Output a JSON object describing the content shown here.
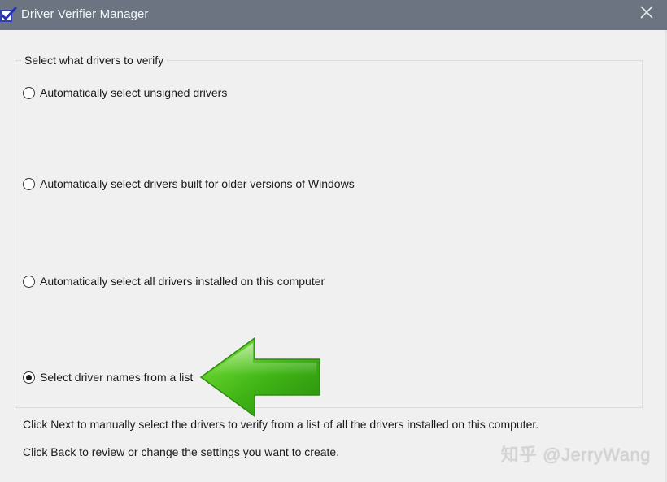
{
  "window": {
    "title": "Driver Verifier Manager",
    "close_glyph": "✕",
    "app_icon": "driver-verifier-checkbox-icon"
  },
  "group": {
    "legend": "Select what drivers to verify",
    "options": [
      {
        "label": "Automatically select unsigned drivers",
        "selected": false
      },
      {
        "label": "Automatically select drivers built for older versions of Windows",
        "selected": false
      },
      {
        "label": "Automatically select all drivers installed on this computer",
        "selected": false
      },
      {
        "label": "Select driver names from a list",
        "selected": true
      }
    ]
  },
  "info": {
    "next_text": "Click Next to manually select the drivers to verify from a list of all the drivers installed on this computer.",
    "back_text": "Click Back to review or change the settings you want to create."
  },
  "annotation": {
    "icon": "green-arrow-left-icon"
  },
  "watermark": {
    "text": "知乎 @JerryWang"
  },
  "colors": {
    "titlebar": "#6b7480",
    "window_bg": "#f0f0f0",
    "arrow_green": "#4cc21c"
  }
}
